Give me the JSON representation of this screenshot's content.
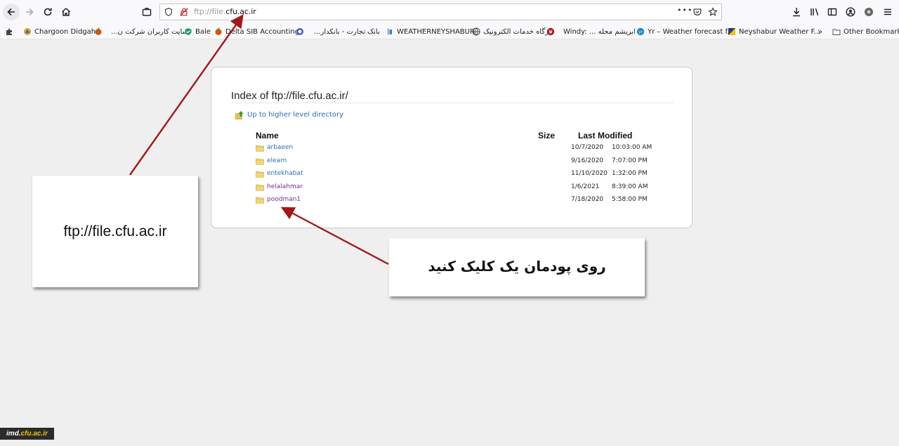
{
  "browser": {
    "url_host": "ftp://file.",
    "url_domain": "cfu.ac.ir",
    "more_label": "•••"
  },
  "bookmarks": [
    {
      "label": "Chargoon Didgah",
      "icon": "chargoon-icon",
      "color": "#e0a020"
    },
    {
      "label": "سایت کاربران شرکت ن...",
      "icon": "fruit-icon",
      "color": "#c85a14",
      "rtl": true
    },
    {
      "label": "Bale",
      "icon": "bale-icon",
      "color": "#1a9e6a"
    },
    {
      "label": "Delta SIB Accounting",
      "icon": "fruit-icon",
      "color": "#c85a14"
    },
    {
      "label": "بانک تجارت - بانکدار...",
      "icon": "bank-icon",
      "color": "#4a5cc7",
      "rtl": true
    },
    {
      "label": "WEATHERNEYSHABUR",
      "icon": "weather-icon",
      "color": "#3c78d8"
    },
    {
      "label": "درگاه خدمات الکترونیک",
      "icon": "globe-icon",
      "color": "#444444",
      "rtl": true
    },
    {
      "label": "Windy: ... ابریشم محله",
      "icon": "windy-icon",
      "color": "#b01818"
    },
    {
      "label": "Yr – Weather forecast f...",
      "icon": "yr-icon",
      "color": "#1b8ad8"
    },
    {
      "label": "Neyshabur Weather F...",
      "icon": "flag-icon",
      "color": "#1e3a8a"
    },
    {
      "label": "Other Bookmarks",
      "icon": "folder-icon",
      "color": "#555555"
    }
  ],
  "listing": {
    "title": "Index of ftp://file.cfu.ac.ir/",
    "up_label": "Up to higher level directory",
    "col_name": "Name",
    "col_size": "Size",
    "col_modified": "Last Modified",
    "files": [
      {
        "name": "arbaeen",
        "date": "10/7/2020",
        "time": "10:03:00 AM",
        "visited": false
      },
      {
        "name": "elearn",
        "date": "9/16/2020",
        "time": "7:07:00 PM",
        "visited": false
      },
      {
        "name": "entekhabat",
        "date": "11/10/2020",
        "time": "1:32:00 PM",
        "visited": false
      },
      {
        "name": "helalahmar",
        "date": "1/6/2021",
        "time": "8:39:00 AM",
        "visited": true
      },
      {
        "name": "poodman1",
        "date": "7/18/2020",
        "time": "5:58:00 PM",
        "visited": true
      }
    ]
  },
  "annotations": {
    "left_text": "ftp://file.cfu.ac.ir",
    "right_text": "روی پودمان یک کلیک کنید",
    "arrow_color": "#a31818"
  },
  "watermark": {
    "prefix": "imd.",
    "accent": "cfu.ac.ir"
  }
}
